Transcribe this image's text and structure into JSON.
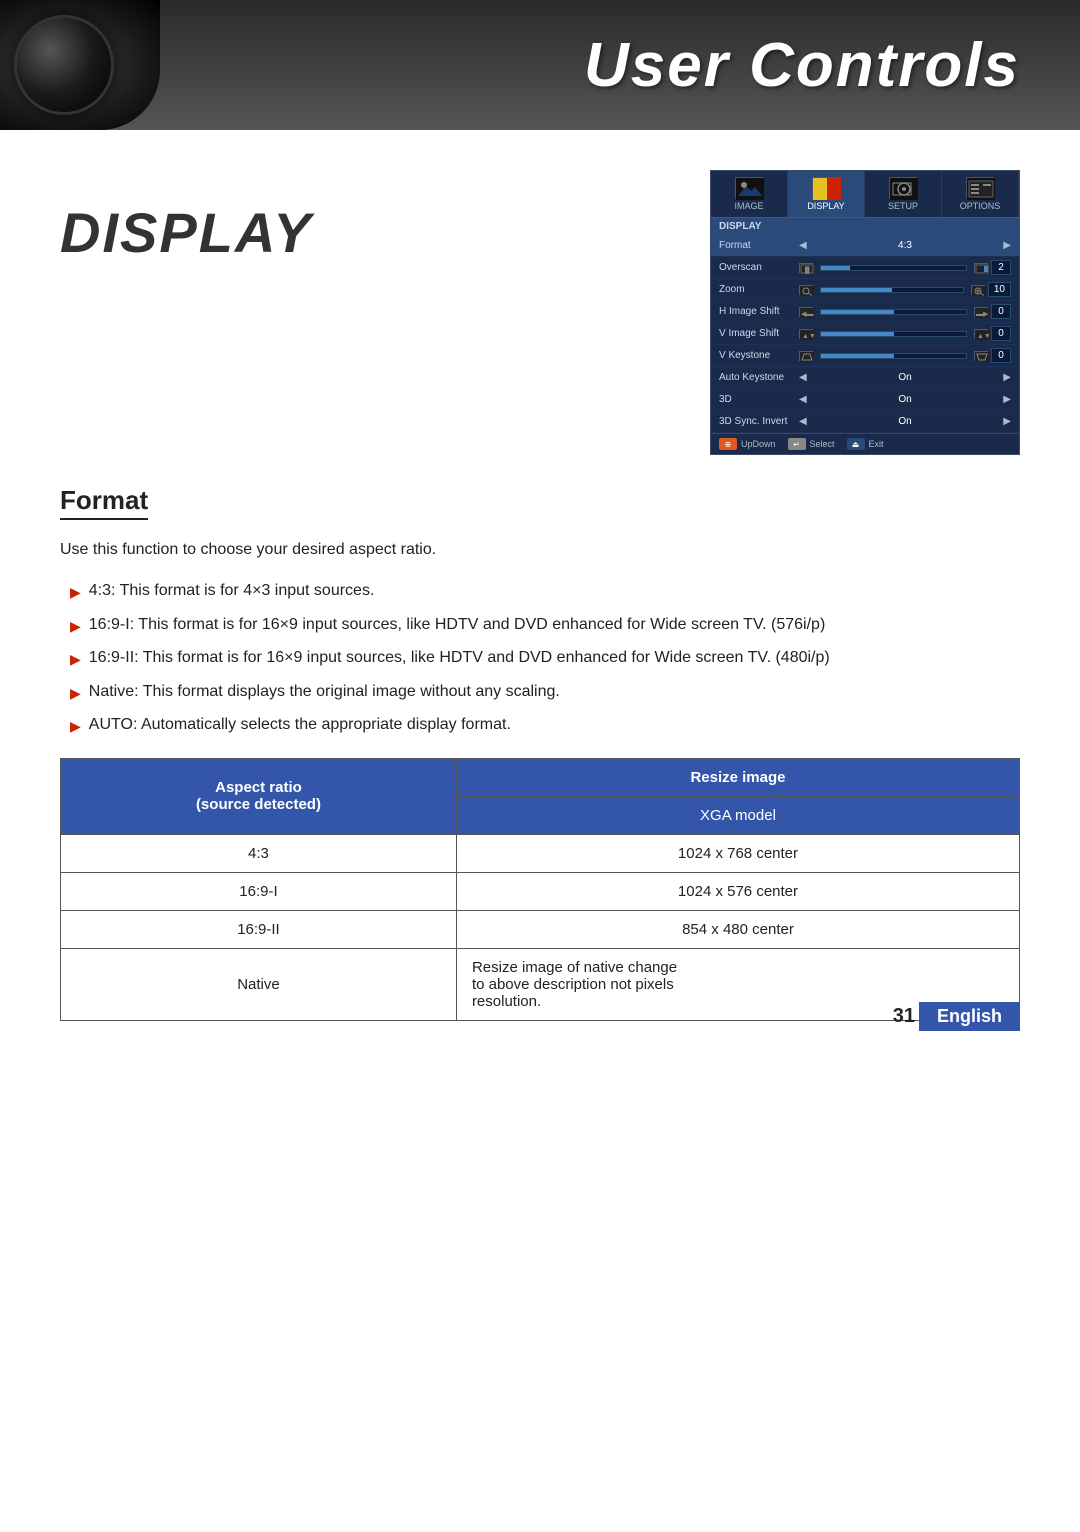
{
  "header": {
    "title": "User Controls"
  },
  "display_label": "DISPLAY",
  "osd": {
    "tabs": [
      {
        "label": "IMAGE",
        "active": false
      },
      {
        "label": "DISPLAY",
        "active": true
      },
      {
        "label": "SETUP",
        "active": false
      },
      {
        "label": "OPTIONS",
        "active": false
      }
    ],
    "section": "DISPLAY",
    "rows": [
      {
        "label": "Format",
        "type": "arrow",
        "value": "4:3"
      },
      {
        "label": "Overscan",
        "type": "slider",
        "value": "2"
      },
      {
        "label": "Zoom",
        "type": "slider",
        "value": "10"
      },
      {
        "label": "H Image Shift",
        "type": "slider",
        "value": "0"
      },
      {
        "label": "V Image Shift",
        "type": "slider",
        "value": "0"
      },
      {
        "label": "V Keystone",
        "type": "slider",
        "value": "0"
      },
      {
        "label": "Auto Keystone",
        "type": "arrow",
        "value": "On"
      },
      {
        "label": "3D",
        "type": "arrow",
        "value": "On"
      },
      {
        "label": "3D Sync. Invert",
        "type": "arrow",
        "value": "On"
      }
    ],
    "footer": [
      {
        "icon": "updown",
        "label": "UpDown"
      },
      {
        "icon": "select",
        "label": "Select"
      },
      {
        "icon": "exit",
        "label": "Exit"
      }
    ]
  },
  "section": {
    "heading": "Format",
    "intro": "Use this function to choose your desired aspect ratio.",
    "bullets": [
      "4:3: This format is for 4×3 input sources.",
      "16:9-I: This format is for 16×9 input sources, like HDTV and DVD enhanced for Wide screen TV. (576i/p)",
      "16:9-II: This format is for 16×9 input sources, like HDTV and DVD enhanced for Wide screen TV. (480i/p)",
      "Native: This format displays the original image without any scaling.",
      "AUTO: Automatically selects the appropriate display format."
    ]
  },
  "table": {
    "col1_header": "Aspect ratio\n(source detected)",
    "col2_header": "Resize image",
    "col2_subheader": "XGA model",
    "rows": [
      {
        "aspect": "4:3",
        "resize": "1024 x 768 center"
      },
      {
        "aspect": "16:9-I",
        "resize": "1024 x 576 center"
      },
      {
        "aspect": "16:9-II",
        "resize": "854 x 480 center"
      },
      {
        "aspect": "Native",
        "resize": "Resize image of native change\nto above description not pixels\nresolution."
      }
    ]
  },
  "footer": {
    "page_number": "31",
    "language": "English"
  }
}
